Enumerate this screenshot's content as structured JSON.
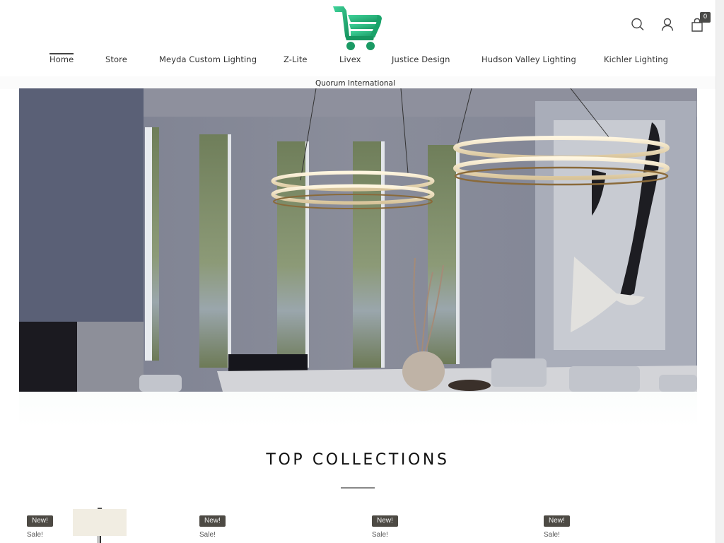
{
  "header": {
    "logo_alt": "Shopping cart logo",
    "brand_color": "#2bb57f",
    "icons": {
      "search": "search-icon",
      "account": "user-icon",
      "cart": "shopping-bag-icon"
    },
    "cart_count": "0"
  },
  "nav": {
    "items": [
      {
        "label": "Home",
        "active": true
      },
      {
        "label": "Store"
      },
      {
        "label": "Meyda Custom Lighting"
      },
      {
        "label": "Z-Lite"
      },
      {
        "label": "Livex"
      },
      {
        "label": "Justice Design"
      },
      {
        "label": "Hudson Valley Lighting"
      },
      {
        "label": "Kichler Lighting"
      },
      {
        "label": "Quorum International"
      }
    ]
  },
  "hero": {
    "description": "Dining room with two gold ring LED pendant chandeliers, abstract wall art, and window view of trees"
  },
  "section": {
    "title": "TOP COLLECTIONS"
  },
  "products": [
    {
      "badge_new": "New!",
      "badge_sale": "Sale!",
      "image": "table-lamp"
    },
    {
      "badge_new": "New!",
      "badge_sale": "Sale!"
    },
    {
      "badge_new": "New!",
      "badge_sale": "Sale!"
    },
    {
      "badge_new": "New!",
      "badge_sale": "Sale!"
    }
  ]
}
